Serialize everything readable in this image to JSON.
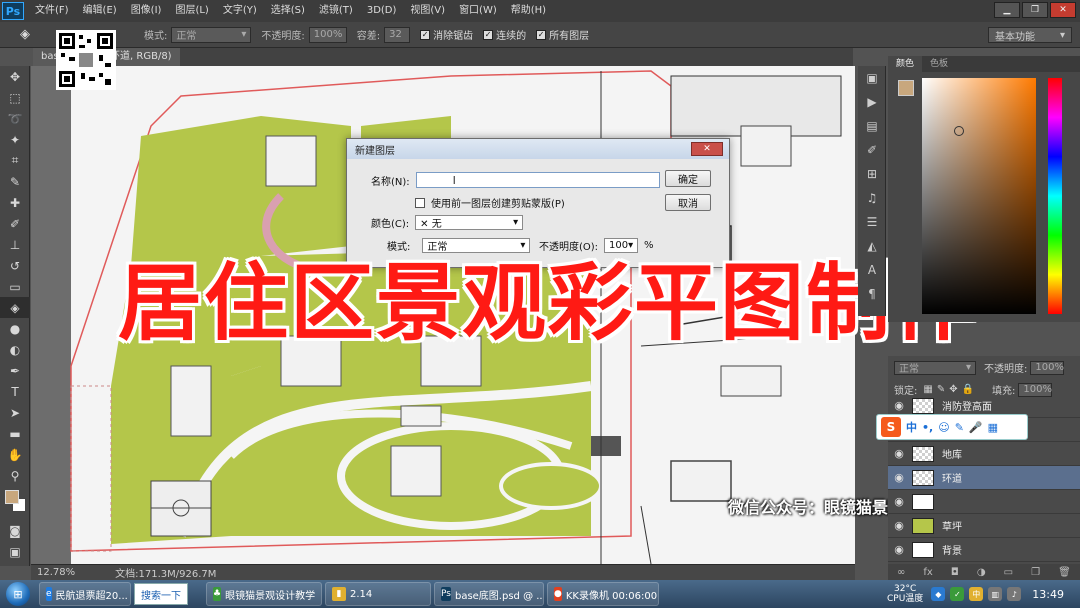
{
  "app": {
    "logo": "Ps",
    "menus": [
      "文件(F)",
      "编辑(E)",
      "图像(I)",
      "图层(L)",
      "文字(Y)",
      "选择(S)",
      "滤镜(T)",
      "3D(D)",
      "视图(V)",
      "窗口(W)",
      "帮助(H)"
    ],
    "window_buttons": [
      "▁",
      "❐",
      "✕"
    ]
  },
  "options": {
    "mode_label": "模式:",
    "mode_value": "正常",
    "opacity_label": "不透明度:",
    "opacity_value": "100%",
    "tolerance_label": "容差:",
    "tolerance_value": "32",
    "antialias_label": "消除锯齿",
    "contiguous_label": "连续的",
    "all_layers_label": "所有图层",
    "workspace_value": "基本功能"
  },
  "document": {
    "tab_label": "base... 2.8% (环道, RGB/8)",
    "zoom": "12.78%",
    "doc_info": "文档:171.3M/926.7M"
  },
  "dialog": {
    "title": "新建图层",
    "close": "✕",
    "name_label": "名称(N):",
    "name_value": "",
    "clip_label": "使用前一图层创建剪贴蒙版(P)",
    "color_label": "颜色(C):",
    "color_value": "无",
    "mode_label": "模式:",
    "mode_value": "正常",
    "opacity_label": "不透明度(O):",
    "opacity_value": "100",
    "opacity_unit": "%",
    "ok": "确定",
    "cancel": "取消"
  },
  "overlay": {
    "title": "居住区景观彩平图制作",
    "wechat": "微信公众号：眼镜猫景观设计教学"
  },
  "color_panel": {
    "tab_color": "颜色",
    "tab_swatches": "色板",
    "fg_color": "#c8a77d"
  },
  "layers_panel": {
    "blend_mode": "正常",
    "opacity_label": "不透明度:",
    "opacity_value": "100%",
    "lock_label": "锁定:",
    "fill_label": "填充:",
    "fill_value": "100%",
    "layers": [
      {
        "name": "消防登高面",
        "thumb": "checker",
        "selected": false
      },
      {
        "name": "",
        "thumb": "checker",
        "selected": false
      },
      {
        "name": "地库",
        "thumb": "checker",
        "selected": false
      },
      {
        "name": "环道",
        "thumb": "checker",
        "selected": true
      },
      {
        "name": "",
        "thumb": "white",
        "selected": false
      },
      {
        "name": "草坪",
        "thumb": "grass",
        "selected": false
      },
      {
        "name": "背景",
        "thumb": "white",
        "selected": false
      }
    ]
  },
  "ime": {
    "logo": "S",
    "glyphs": [
      "中",
      "•,",
      "☺",
      "✎",
      "🎤",
      "▦"
    ]
  },
  "taskbar": {
    "tasks": [
      {
        "label": "民航退票超20...",
        "icon": "e",
        "color": "#1e7be0"
      },
      {
        "label": "眼镜猫景观设计教学",
        "icon": "♣",
        "color": "#3a9a3a"
      },
      {
        "label": "2.14",
        "icon": "▮",
        "color": "#e0b030"
      },
      {
        "label": "base底图.psd @ ...",
        "icon": "Ps",
        "color": "#0f3d5e"
      },
      {
        "label": "KK录像机 00:06:00",
        "icon": "●",
        "color": "#e04020"
      }
    ],
    "search_label": "搜索一下",
    "temp_value": "32°C",
    "temp_label": "CPU温度",
    "clock": "13:49"
  }
}
